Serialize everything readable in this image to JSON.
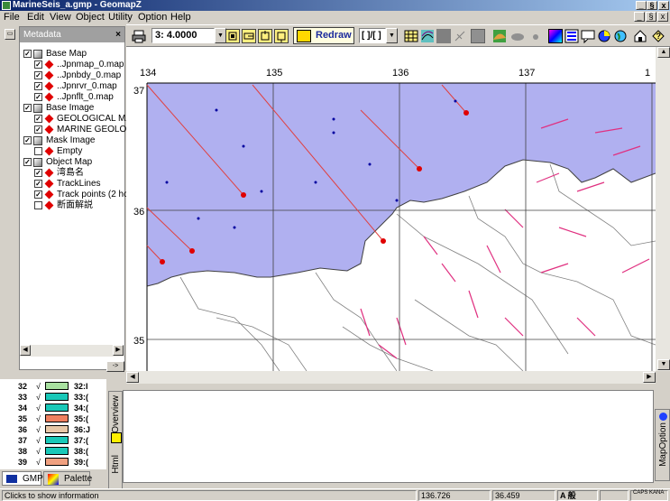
{
  "window": {
    "title": "MarineSeis_a.gmp - GeomapZ",
    "controls": [
      "_",
      "§",
      "x"
    ],
    "mdi_controls": [
      "_",
      "§",
      "x"
    ]
  },
  "menu": [
    "File",
    "Edit",
    "View",
    "Object",
    "Utility",
    "Option",
    "Help"
  ],
  "toolbar": {
    "scale_value": "3:  4.0000",
    "redraw_label": "Redraw",
    "mode_value": "[ ]/[ ]",
    "icons": [
      "print-icon",
      "zoom-in-icon",
      "zoom-out-icon",
      "zoom-window-icon",
      "zoom-extent-icon",
      "grid-icon",
      "contour-icon",
      "fill-icon",
      "pen-icon",
      "layer-icon",
      "terrain-icon",
      "cloud-icon",
      "dot-icon",
      "color-table-icon",
      "legend-icon",
      "comment-icon",
      "pie-icon",
      "globe-icon",
      "home-icon",
      "help-icon"
    ]
  },
  "metadata_panel": {
    "title": "Metadata",
    "tree": [
      {
        "label": "Base Map",
        "checked": true,
        "level": 0,
        "icon": "folder-icon"
      },
      {
        "label": "..Jpnmap_0.map",
        "checked": true,
        "level": 1,
        "icon": "red-diamond-icon"
      },
      {
        "label": "..Jpnbdy_0.map",
        "checked": true,
        "level": 1,
        "icon": "red-diamond-icon"
      },
      {
        "label": "..Jpnrvr_0.map",
        "checked": true,
        "level": 1,
        "icon": "red-diamond-icon"
      },
      {
        "label": "..Jpnflt_0.map",
        "checked": true,
        "level": 1,
        "icon": "red-diamond-icon"
      },
      {
        "label": "Base Image",
        "checked": true,
        "level": 0,
        "icon": "folder-icon"
      },
      {
        "label": "GEOLOGICAL MA",
        "checked": true,
        "level": 1,
        "icon": "red-diamond-icon"
      },
      {
        "label": "MARINE GEOLOG",
        "checked": true,
        "level": 1,
        "icon": "red-diamond-icon"
      },
      {
        "label": "Mask Image",
        "checked": true,
        "level": 0,
        "icon": "folder-icon"
      },
      {
        "label": "Empty",
        "checked": false,
        "level": 1,
        "icon": "red-diamond-icon"
      },
      {
        "label": "Object Map",
        "checked": true,
        "level": 0,
        "icon": "folder-icon"
      },
      {
        "label": "湾島名",
        "checked": true,
        "level": 1,
        "icon": "red-diamond-icon"
      },
      {
        "label": "TrackLines",
        "checked": true,
        "level": 1,
        "icon": "red-diamond-icon"
      },
      {
        "label": "Track points (2 hc",
        "checked": true,
        "level": 1,
        "icon": "red-diamond-icon"
      },
      {
        "label": "断面解説",
        "checked": false,
        "level": 1,
        "icon": "red-diamond-icon"
      }
    ],
    "arrow_button": "->"
  },
  "palette": {
    "rows": [
      {
        "n": "32",
        "color": "#a8e0a0",
        "label": "32:I"
      },
      {
        "n": "33",
        "color": "#19c8b8",
        "label": "33:("
      },
      {
        "n": "34",
        "color": "#19c8b8",
        "label": "34:("
      },
      {
        "n": "35",
        "color": "#f08060",
        "label": "35:("
      },
      {
        "n": "36",
        "color": "#e8c8a8",
        "label": "36:J"
      },
      {
        "n": "37",
        "color": "#19c8b8",
        "label": "37:("
      },
      {
        "n": "38",
        "color": "#19c8b8",
        "label": "38:("
      },
      {
        "n": "39",
        "color": "#f0a080",
        "label": "39:("
      }
    ],
    "check": "√"
  },
  "map": {
    "x_labels": [
      "134",
      "135",
      "136",
      "137",
      "1"
    ],
    "y_labels": [
      "37",
      "36",
      "35"
    ],
    "sea_color": "#b0b0f0",
    "land_color": "#ffffff"
  },
  "side_tabs": {
    "overview": "Overview",
    "html": "Html",
    "mapoption": "MapOption"
  },
  "bottom_tabs": {
    "gmp": "GMP",
    "palette": "Palette"
  },
  "status": {
    "message": "Clicks to show information",
    "lon": "136.726",
    "lat": "36.459",
    "ime": "A 般",
    "caps": "CAPS KANA"
  }
}
